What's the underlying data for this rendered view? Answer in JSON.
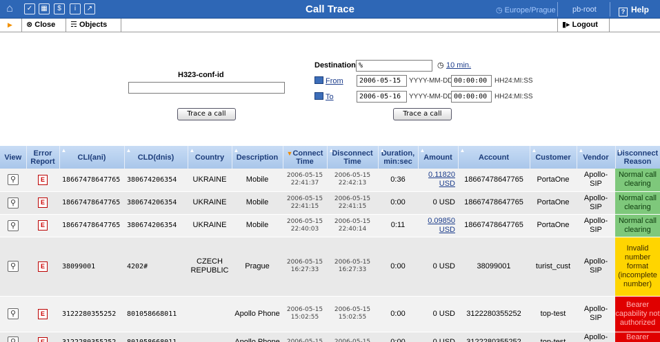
{
  "topbar": {
    "title": "Call Trace",
    "timezone": "Europe/Prague",
    "user": "pb-root",
    "help": "Help",
    "icons": [
      "home-icon",
      "checkbox-icon",
      "grid-icon",
      "dollar-icon",
      "info-icon",
      "chart-icon"
    ]
  },
  "toolbar": {
    "close": "Close",
    "objects": "Objects",
    "logout": "Logout"
  },
  "search": {
    "h323_label": "H323-conf-id",
    "h323_value": "",
    "trace_button": "Trace a call",
    "destination_label": "Destination",
    "destination_value": "%",
    "interval_link": "10 min.",
    "from_label": "From",
    "from_date": "2006-05-15",
    "from_time": "00:00:00",
    "to_label": "To",
    "to_date": "2006-05-16",
    "to_time": "00:00:00",
    "date_hint": "YYYY-MM-DD",
    "time_hint": "HH24:MI:SS",
    "trace_button_2": "Trace a call"
  },
  "table": {
    "headers": {
      "view": "View",
      "error_report_1": "Error",
      "error_report_2": "Report",
      "cli": "CLI(ani)",
      "cld": "CLD(dnis)",
      "country": "Country",
      "description": "Description",
      "connect_1": "Connect",
      "connect_2": "Time",
      "disconnect_1": "Disconnect",
      "disconnect_2": "Time",
      "duration_1": "Duration,",
      "duration_2": "min:sec",
      "amount": "Amount",
      "account": "Account",
      "customer": "Customer",
      "vendor": "Vendor",
      "reason_1": "Disconnect",
      "reason_2": "Reason"
    },
    "error_glyph": "E",
    "rows": [
      {
        "cli": "18667478647765",
        "cld": "380674206354",
        "country": "UKRAINE",
        "description": "Mobile",
        "connect_date": "2006-05-15",
        "connect_time": "22:41:37",
        "disconnect_date": "2006-05-15",
        "disconnect_time": "22:42:13",
        "duration": "0:36",
        "amount_value": "0.11820",
        "amount_currency": "USD",
        "account": "18667478647765",
        "customer": "PortaOne",
        "vendor_1": "Apollo-",
        "vendor_2": "SIP",
        "reason_lines": [
          "Normal call",
          "clearing"
        ],
        "reason_color": "green"
      },
      {
        "cli": "18667478647765",
        "cld": "380674206354",
        "country": "UKRAINE",
        "description": "Mobile",
        "connect_date": "2006-05-15",
        "connect_time": "22:41:15",
        "disconnect_date": "2006-05-15",
        "disconnect_time": "22:41:15",
        "duration": "0:00",
        "amount_text": "0 USD",
        "account": "18667478647765",
        "customer": "PortaOne",
        "vendor_1": "Apollo-",
        "vendor_2": "SIP",
        "reason_lines": [
          "Normal call",
          "clearing"
        ],
        "reason_color": "green"
      },
      {
        "cli": "18667478647765",
        "cld": "380674206354",
        "country": "UKRAINE",
        "description": "Mobile",
        "connect_date": "2006-05-15",
        "connect_time": "22:40:03",
        "disconnect_date": "2006-05-15",
        "disconnect_time": "22:40:14",
        "duration": "0:11",
        "amount_value": "0.09850",
        "amount_currency": "USD",
        "account": "18667478647765",
        "customer": "PortaOne",
        "vendor_1": "Apollo-",
        "vendor_2": "SIP",
        "reason_lines": [
          "Normal call",
          "clearing"
        ],
        "reason_color": "green"
      },
      {
        "cli": "38099001",
        "cld": "4202#",
        "country_1": "CZECH",
        "country_2": "REPUBLIC",
        "description": "Prague",
        "connect_date": "2006-05-15",
        "connect_time": "16:27:33",
        "disconnect_date": "2006-05-15",
        "disconnect_time": "16:27:33",
        "duration": "0:00",
        "amount_text": "0 USD",
        "account": "38099001",
        "customer": "turist_cust",
        "vendor_1": "Apollo-",
        "vendor_2": "SIP",
        "reason_lines": [
          "Invalid",
          "number",
          "format",
          "(incomplete",
          "number)"
        ],
        "reason_color": "yellow"
      },
      {
        "cli": "3122280355252",
        "cld": "801058668011",
        "country": "",
        "description": "Apollo Phone",
        "connect_date": "2006-05-15",
        "connect_time": "15:02:55",
        "disconnect_date": "2006-05-15",
        "disconnect_time": "15:02:55",
        "duration": "0:00",
        "amount_text": "0 USD",
        "account": "3122280355252",
        "customer": "top-test",
        "vendor_1": "Apollo-",
        "vendor_2": "SIP",
        "reason_lines": [
          "Bearer",
          "capability not",
          "authorized"
        ],
        "reason_color": "red"
      },
      {
        "cli": "3122280355252",
        "cld": "801058668011",
        "country": "",
        "description": "Apollo Phone",
        "connect_date": "2006-05-15",
        "connect_time": "",
        "disconnect_date": "2006-05-15",
        "disconnect_time": "",
        "duration": "0:00",
        "amount_text": "0 USD",
        "account": "3122280355252",
        "customer": "top-test",
        "vendor_1": "Apollo-",
        "vendor_2": "SIP",
        "reason_lines": [
          "Bearer",
          "capability not"
        ],
        "reason_color": "red"
      }
    ]
  }
}
